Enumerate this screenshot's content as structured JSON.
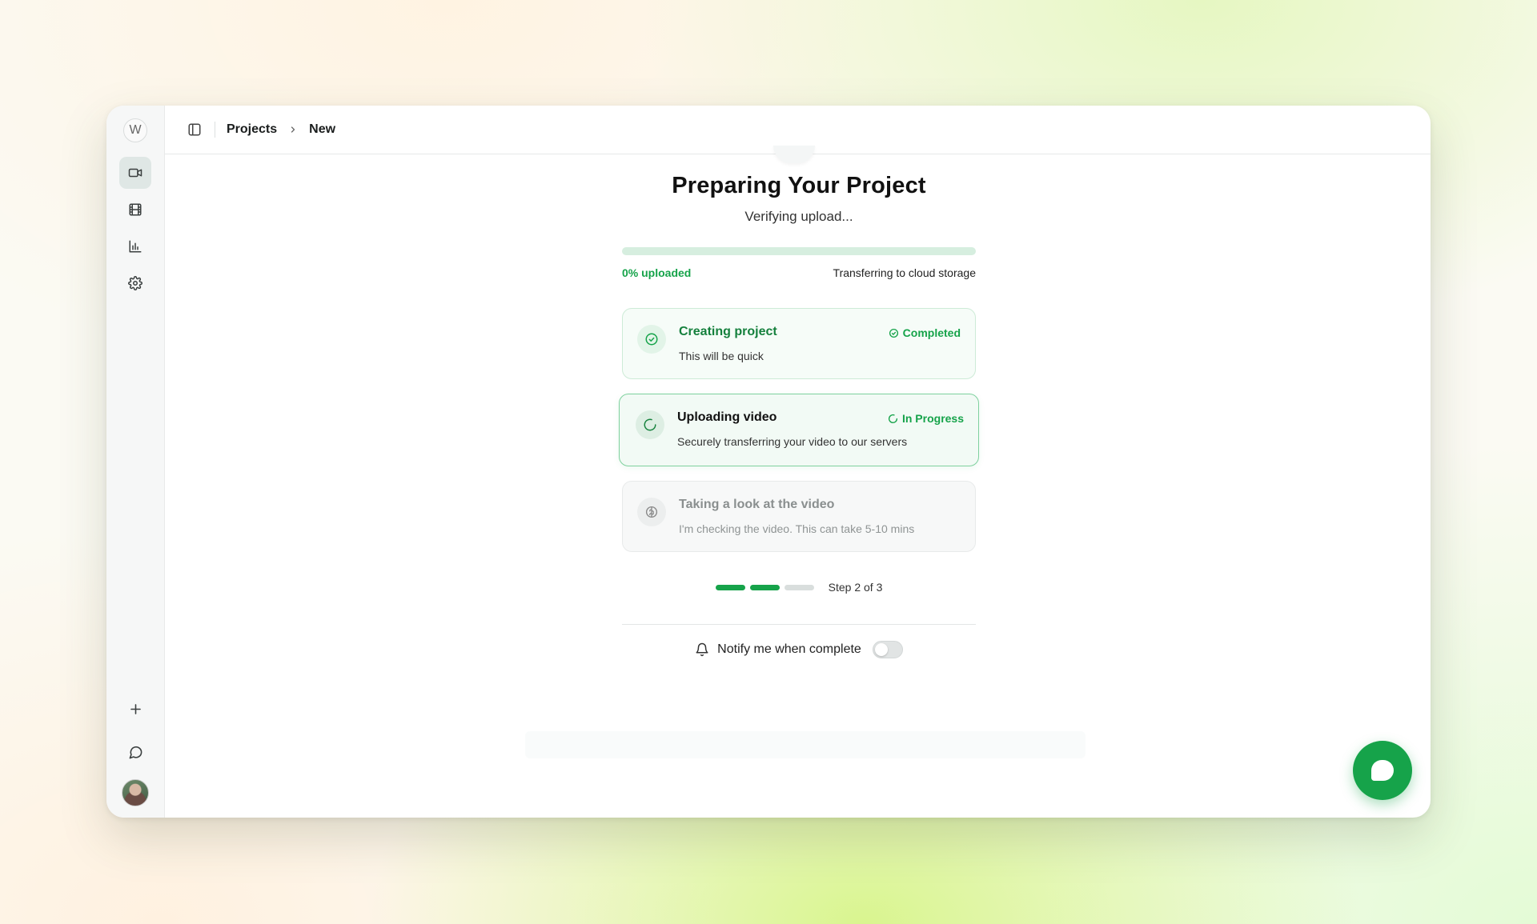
{
  "app": {
    "logo_letter": "W"
  },
  "sidebar": {
    "items": [
      {
        "name": "video",
        "icon": "video-camera-icon",
        "active": true
      },
      {
        "name": "film",
        "icon": "film-icon",
        "active": false
      },
      {
        "name": "analytics",
        "icon": "bar-chart-icon",
        "active": false
      },
      {
        "name": "settings",
        "icon": "gear-icon",
        "active": false
      }
    ],
    "bottom": [
      "plus-icon",
      "chat-bubble-icon",
      "user-avatar"
    ]
  },
  "breadcrumb": {
    "items": [
      "Projects",
      "New"
    ]
  },
  "main": {
    "title": "Preparing Your Project",
    "subtitle": "Verifying upload...",
    "progress": {
      "fraction": 0,
      "percent_label": "0% uploaded",
      "destination": "Transferring to cloud storage"
    },
    "steps": [
      {
        "title": "Creating project",
        "description": "This will be quick",
        "status": "Completed",
        "state": "completed"
      },
      {
        "title": "Uploading video",
        "description": "Securely transferring your video to our servers",
        "status": "In Progress",
        "state": "active"
      },
      {
        "title": "Taking a look at the video",
        "description": "I'm checking the video. This can take 5-10 mins",
        "status": "",
        "state": "pending"
      }
    ],
    "step_indicator": {
      "current": 2,
      "total": 3,
      "label": "Step 2 of 3"
    },
    "notify": {
      "label": "Notify me when complete",
      "enabled": false
    }
  },
  "colors": {
    "accent": "#16a34a",
    "accent_light": "#d6eedf",
    "card_border": "#cdebd7"
  }
}
